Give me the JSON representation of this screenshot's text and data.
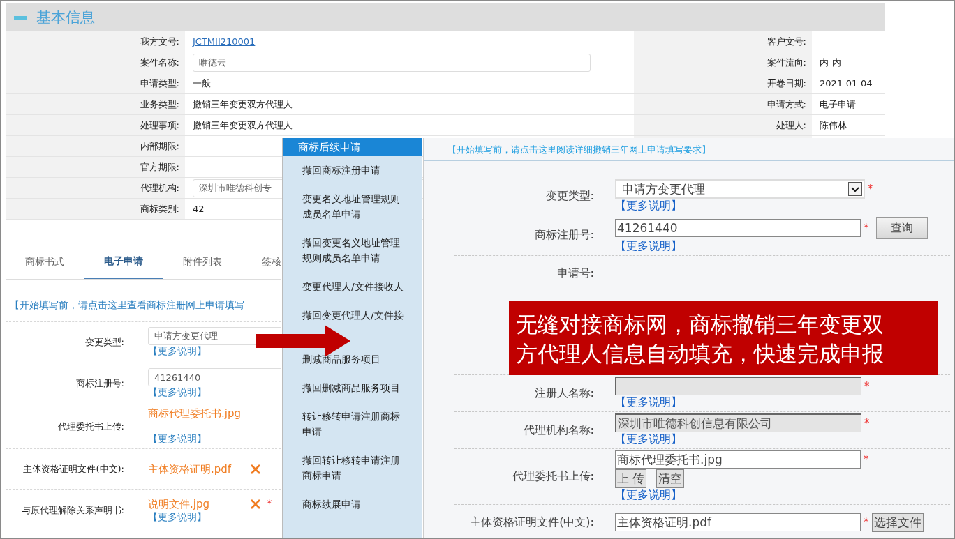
{
  "section": {
    "title": "基本信息"
  },
  "info_left": [
    {
      "label": "我方文号:",
      "value": "JCTMII210001",
      "kind": "link"
    },
    {
      "label": "案件名称:",
      "value": "唯德云",
      "kind": "input"
    },
    {
      "label": "申请类型:",
      "value": "一般",
      "kind": "text"
    },
    {
      "label": "业务类型:",
      "value": "撤销三年变更双方代理人",
      "kind": "text"
    },
    {
      "label": "处理事项:",
      "value": "撤销三年变更双方代理人",
      "kind": "text"
    },
    {
      "label": "内部期限:",
      "kind": "text"
    },
    {
      "label": "官方期限:",
      "kind": "text"
    },
    {
      "label": "代理机构:",
      "value": "深圳市唯德科创专",
      "kind": "input"
    },
    {
      "label": "商标类别:",
      "value": "42",
      "kind": "text"
    }
  ],
  "info_right": [
    {
      "label": "客户文号:"
    },
    {
      "label": "案件流向:",
      "value": "内-内"
    },
    {
      "label": "开卷日期:",
      "value": "2021-01-04"
    },
    {
      "label": "申请方式:",
      "value": "电子申请"
    },
    {
      "label": "处理人:",
      "value": "陈伟林"
    }
  ],
  "tabs": [
    {
      "label": "商标书式",
      "selected": false
    },
    {
      "label": "电子申请",
      "selected": true
    },
    {
      "label": "附件列表",
      "selected": false
    },
    {
      "label": "签核",
      "selected": false
    }
  ],
  "left_form": {
    "notice": "【开始填写前，请点击这里查看商标注册网上申请填写",
    "rows": [
      {
        "label": "变更类型:",
        "kind": "select",
        "value": "申请方变更代理",
        "more": "【更多说明】"
      },
      {
        "label": "商标注册号:",
        "kind": "input",
        "value": "41261440",
        "more": "【更多说明】"
      },
      {
        "label": "代理委托书上传:",
        "kind": "file",
        "value": "商标代理委托书.jpg",
        "more": "【更多说明】"
      },
      {
        "label": "主体资格证明文件(中文):",
        "kind": "file_removable",
        "value": "主体资格证明.pdf"
      },
      {
        "label": "与原代理解除关系声明书:",
        "kind": "file_removable",
        "value": "说明文件.jpg",
        "more": "【更多说明】",
        "required_mark": "*"
      }
    ]
  },
  "menu": {
    "header": "商标后续申请",
    "items": [
      {
        "label": "撤回商标注册申请"
      },
      {
        "label": "变更名义地址管理规则成员名单申请"
      },
      {
        "label": "撤回变更名义地址管理规则成员名单申请"
      },
      {
        "label": "变更代理人/文件接收人"
      },
      {
        "label": "撤回变更代理人/文件接",
        "kind": "covered"
      },
      {
        "label": "删减商品服务项目"
      },
      {
        "label": "撤回删减商品服务项目"
      },
      {
        "label": "转让移转申请注册商标申请"
      },
      {
        "label": "撤回转让移转申请注册商标申请"
      },
      {
        "label": "商标续展申请"
      }
    ]
  },
  "right_form": {
    "notice": "【开始填写前，请点击这里阅读详细撤销三年网上申请填写要求】",
    "rows": [
      {
        "label": "变更类型:",
        "kind": "select",
        "value": "申请方变更代理",
        "required_mark": "*",
        "more": "【更多说明】"
      },
      {
        "label": "商标注册号:",
        "kind": "input",
        "value": "41261440",
        "required_mark": "*",
        "disabled": false,
        "buttons": [
          "查询"
        ],
        "more": "【更多说明】"
      },
      {
        "label": "申请号:",
        "kind": "text"
      },
      {
        "kind": "covered"
      },
      {
        "label": "注册人名称:",
        "kind": "input",
        "required_mark": "*",
        "disabled": true,
        "more": "【更多说明】"
      },
      {
        "label": "代理机构名称:",
        "kind": "input",
        "value": "深圳市唯德科创信息有限公司",
        "required_mark": "*",
        "disabled": true,
        "more": "【更多说明】"
      },
      {
        "label": "代理委托书上传:",
        "kind": "input",
        "value": "商标代理委托书.jpg",
        "required_mark": "*",
        "disabled": false,
        "buttons": [
          "上 传",
          "清空"
        ],
        "more": "【更多说明】"
      },
      {
        "label": "主体资格证明文件(中文):",
        "kind": "input",
        "value": "主体资格证明.pdf",
        "required_mark": "*",
        "disabled": false,
        "side_button": "选择文件"
      }
    ]
  },
  "callout": {
    "lines": [
      "无缝对接商标网，商标撤销三年变更双",
      "方代理人信息自动填充，快速完成申报"
    ]
  }
}
